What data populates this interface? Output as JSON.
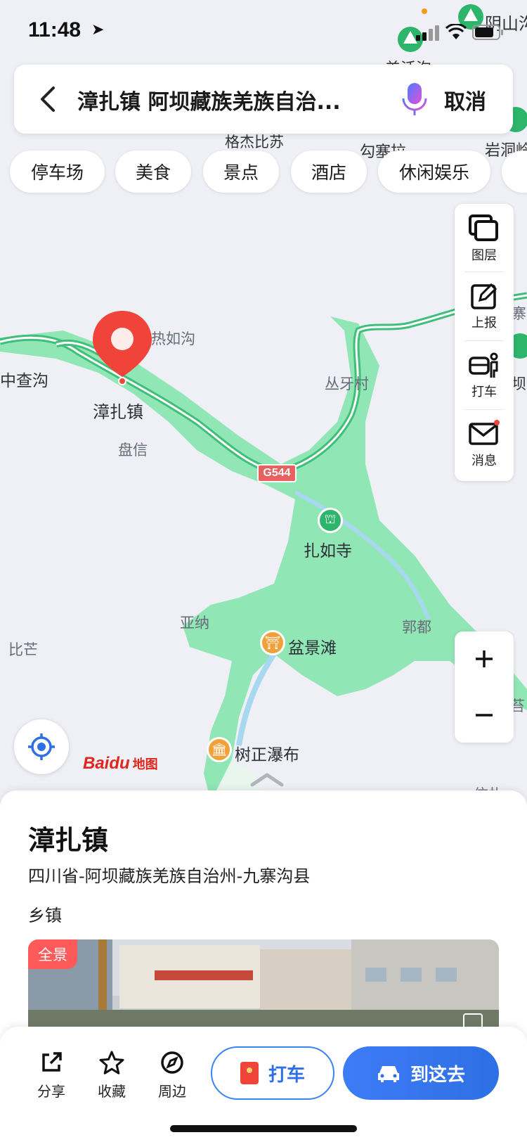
{
  "status_bar": {
    "time": "11:48"
  },
  "search": {
    "query": "漳扎镇 阿坝藏族羌族自治...",
    "cancel_label": "取消"
  },
  "chips": [
    "停车场",
    "美食",
    "景点",
    "酒店",
    "休闲娱乐"
  ],
  "tools": [
    {
      "label": "图层",
      "icon": "layers-icon"
    },
    {
      "label": "上报",
      "icon": "report-icon"
    },
    {
      "label": "打车",
      "icon": "taxi-icon"
    },
    {
      "label": "消息",
      "icon": "message-icon"
    }
  ],
  "map": {
    "labels": {
      "yinshan": "阴山沟",
      "qianghuogou": "羌活沟",
      "gejie": "格杰比苏",
      "gousai": "勾塞拉",
      "yandong": "岩洞岭",
      "rerugou": "热如沟",
      "zhongchagou": "中查沟",
      "zhangzhazhen": "漳扎镇",
      "panxin": "盘信",
      "congya": "丛牙村",
      "road": "G544",
      "zharusi": "扎如寺",
      "yana": "亚纳",
      "guodu": "郭都",
      "bimang": "比芒",
      "penjingtan": "盆景滩",
      "shuzheng": "树正瀑布",
      "xinzha": "信扎",
      "ze": "寨",
      "ba": "坝",
      "jing": "苔"
    },
    "logo_text": "Baidu",
    "logo_cn": "地图"
  },
  "place": {
    "name": "漳扎镇",
    "address": "四川省-阿坝藏族羌族自治州-九寨沟县",
    "type": "乡镇",
    "photo_badge": "全景"
  },
  "actions": {
    "share": "分享",
    "favorite": "收藏",
    "nearby": "周边",
    "taxi": "打车",
    "go": "到这去"
  },
  "colors": {
    "accent": "#2f6fe4",
    "scenic_green": "#7fe3a8",
    "road_green": "#3ebd7a",
    "pin_red": "#f0433a"
  }
}
